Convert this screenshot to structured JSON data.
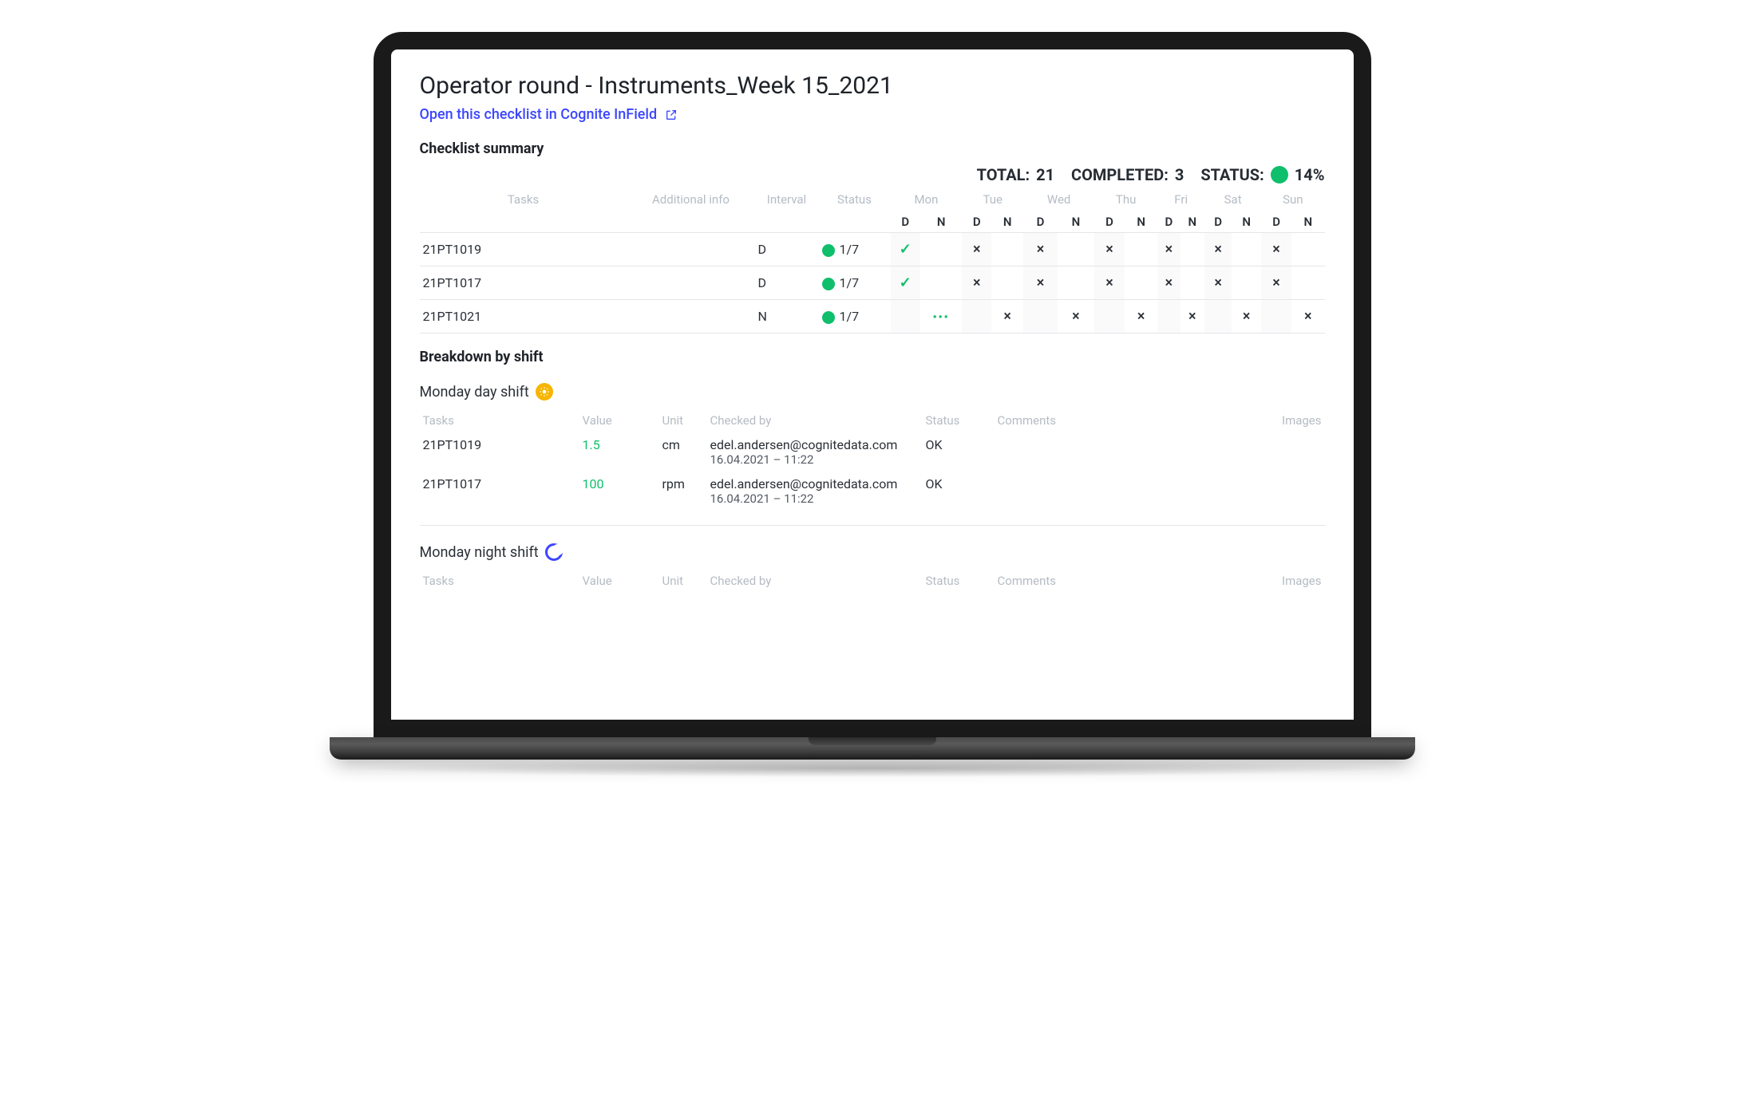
{
  "page": {
    "title": "Operator round - Instruments_Week 15_2021",
    "open_link": "Open this checklist in Cognite InField"
  },
  "summary": {
    "heading": "Checklist summary",
    "total_label": "TOTAL:",
    "total_value": "21",
    "completed_label": "COMPLETED:",
    "completed_value": "3",
    "status_label": "STATUS:",
    "status_percent": "14%",
    "status_color": "#0fbf6b",
    "columns": {
      "tasks": "Tasks",
      "additional_info": "Additional info",
      "interval": "Interval",
      "status": "Status"
    },
    "days": [
      "Mon",
      "Tue",
      "Wed",
      "Thu",
      "Fri",
      "Sat",
      "Sun"
    ],
    "dn": [
      "D",
      "N"
    ],
    "rows": [
      {
        "task": "21PT1019",
        "additional_info": "",
        "interval": "D",
        "status_ratio": "1/7",
        "marks": [
          "check",
          "",
          "x",
          "",
          "x",
          "",
          "x",
          "",
          "x",
          "",
          "x",
          "",
          "x",
          ""
        ]
      },
      {
        "task": "21PT1017",
        "additional_info": "",
        "interval": "D",
        "status_ratio": "1/7",
        "marks": [
          "check",
          "",
          "x",
          "",
          "x",
          "",
          "x",
          "",
          "x",
          "",
          "x",
          "",
          "x",
          ""
        ]
      },
      {
        "task": "21PT1021",
        "additional_info": "",
        "interval": "N",
        "status_ratio": "1/7",
        "marks": [
          "",
          "dots",
          "",
          "x",
          "",
          "x",
          "",
          "x",
          "",
          "x",
          "",
          "x",
          "",
          "x"
        ]
      }
    ]
  },
  "breakdown": {
    "heading": "Breakdown by shift",
    "columns": {
      "tasks": "Tasks",
      "value": "Value",
      "unit": "Unit",
      "checked_by": "Checked by",
      "status": "Status",
      "comments": "Comments",
      "images": "Images"
    },
    "shifts": [
      {
        "title": "Monday day shift",
        "icon": "sun",
        "rows": [
          {
            "task": "21PT1019",
            "value": "1.5",
            "unit": "cm",
            "checked_by": "edel.andersen@cognitedata.com",
            "checked_at": "16.04.2021 – 11:22",
            "status": "OK",
            "comments": "",
            "images": ""
          },
          {
            "task": "21PT1017",
            "value": "100",
            "unit": "rpm",
            "checked_by": "edel.andersen@cognitedata.com",
            "checked_at": "16.04.2021 – 11:22",
            "status": "OK",
            "comments": "",
            "images": ""
          }
        ]
      },
      {
        "title": "Monday night shift",
        "icon": "moon",
        "rows": []
      }
    ]
  }
}
